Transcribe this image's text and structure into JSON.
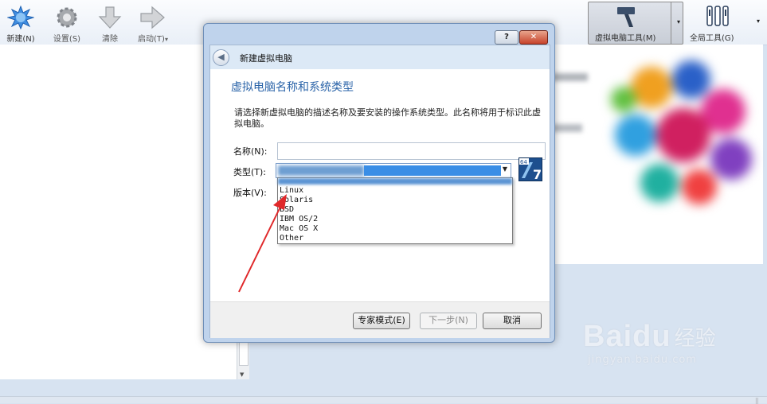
{
  "toolbar": {
    "new_label": "新建(N)",
    "settings_label": "设置(S)",
    "discard_label": "清除",
    "start_label": "启动(T)",
    "start_dropdown": "▾",
    "vm_tools_label": "虚拟电脑工具(M)",
    "global_tools_label": "全局工具(G)",
    "dropdown_arrow": "▾"
  },
  "dialog": {
    "window_title": "新建虚拟电脑",
    "help_button": "?",
    "close_button": "✕",
    "page_title": "虚拟电脑名称和系统类型",
    "description": "请选择新虚拟电脑的描述名称及要安装的操作系统类型。此名称将用于标识此虚拟电脑。",
    "name_label": "名称(N):",
    "name_value": "",
    "type_label": "类型(T):",
    "version_label": "版本(V):",
    "os_icon_badge_text": "64",
    "os_icon_number": "7",
    "type_options": [
      "Linux",
      "Solaris",
      "BSD",
      "IBM OS/2",
      "Mac OS X",
      "Other"
    ],
    "buttons": {
      "expert": "专家模式(E)",
      "next": "下一步(N)",
      "cancel": "取消"
    }
  },
  "watermark": {
    "brand": "Baidu",
    "brand_cn": "经验",
    "url": "jingyan.baidu.com"
  },
  "colors": {
    "accent_blue": "#2a63a8",
    "selection": "#3a8ee6",
    "annotation_arrow": "#e0282a"
  }
}
